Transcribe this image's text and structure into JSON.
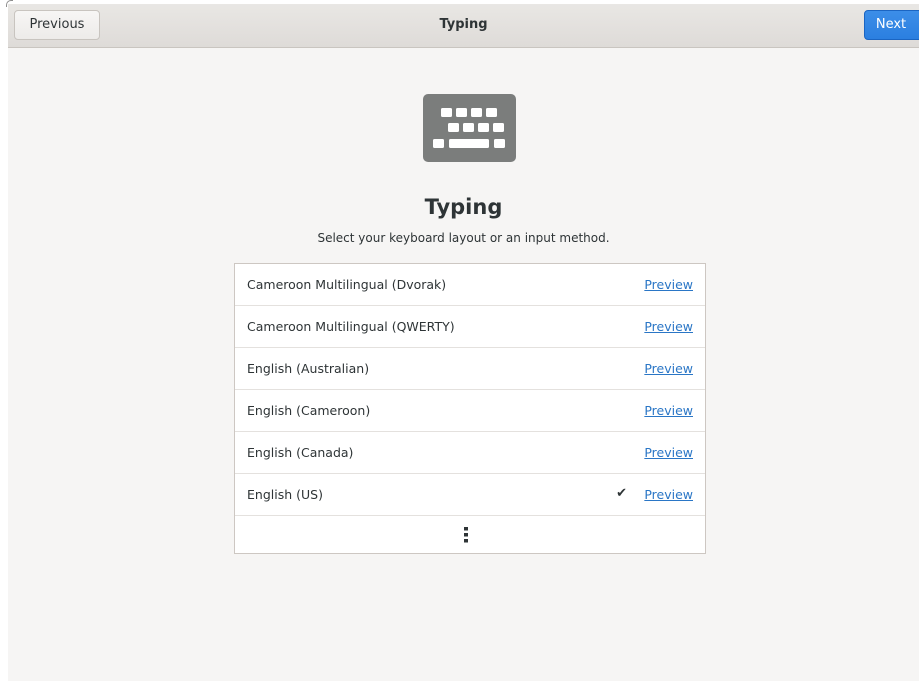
{
  "header": {
    "previous_label": "Previous",
    "title": "Typing",
    "next_label": "Next"
  },
  "page": {
    "icon": "keyboard-icon",
    "title": "Typing",
    "subtitle": "Select your keyboard layout or an input method."
  },
  "layouts": [
    {
      "label": "Cameroon Multilingual (Dvorak)",
      "preview": "Preview",
      "selected": false
    },
    {
      "label": "Cameroon Multilingual (QWERTY)",
      "preview": "Preview",
      "selected": false
    },
    {
      "label": "English (Australian)",
      "preview": "Preview",
      "selected": false
    },
    {
      "label": "English (Cameroon)",
      "preview": "Preview",
      "selected": false
    },
    {
      "label": "English (Canada)",
      "preview": "Preview",
      "selected": false
    },
    {
      "label": "English (US)",
      "preview": "Preview",
      "selected": true,
      "check": "✔"
    }
  ],
  "more": {
    "icon": "more-vertical-icon"
  },
  "colors": {
    "accent": "#3584e4",
    "link": "#2a76c6",
    "icon_gray": "#7b7d7c",
    "background": "#f6f5f4"
  }
}
